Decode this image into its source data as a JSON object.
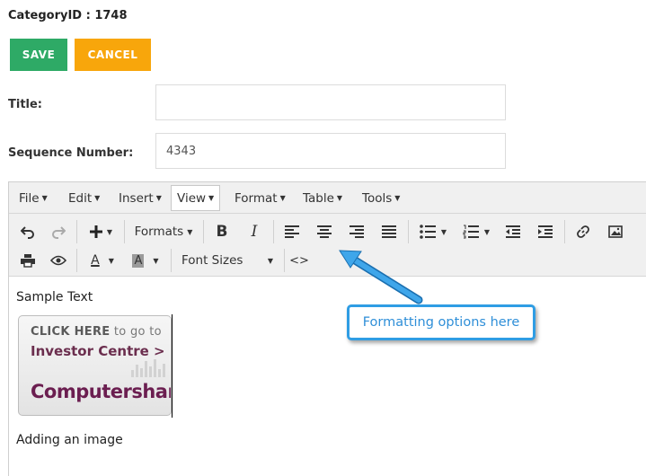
{
  "header": {
    "category_id": "CategoryID : 1748"
  },
  "actions": {
    "save_label": "SAVE",
    "cancel_label": "CANCEL"
  },
  "form": {
    "title_label": "Title:",
    "title_value": "",
    "sequence_label": "Sequence Number:",
    "sequence_value": "4343"
  },
  "editor": {
    "menus": [
      {
        "label": "File"
      },
      {
        "label": "Edit"
      },
      {
        "label": "Insert"
      },
      {
        "label": "View"
      },
      {
        "label": "Format"
      },
      {
        "label": "Table"
      },
      {
        "label": "Tools"
      }
    ],
    "active_menu": "View",
    "toolbar": {
      "formats_label": "Formats",
      "bold_label": "B",
      "italic_label": "I",
      "text_color_label": "A",
      "bg_color_label": "A",
      "font_sizes_label": "Font Sizes",
      "source_code_label": "<>"
    },
    "content": {
      "paragraph1": "Sample Text",
      "paragraph2": "Adding an image",
      "image": {
        "line1_bold": "CLICK HERE",
        "line1_rest": " to go to",
        "line2": "Investor Centre >",
        "logo_text": "Computershare"
      }
    }
  },
  "annotation": {
    "callout_text": "Formatting options here",
    "color": "#2f9de4"
  },
  "colors": {
    "save": "#2eaa66",
    "cancel": "#f8a60b",
    "brand": "#6b1e50"
  }
}
